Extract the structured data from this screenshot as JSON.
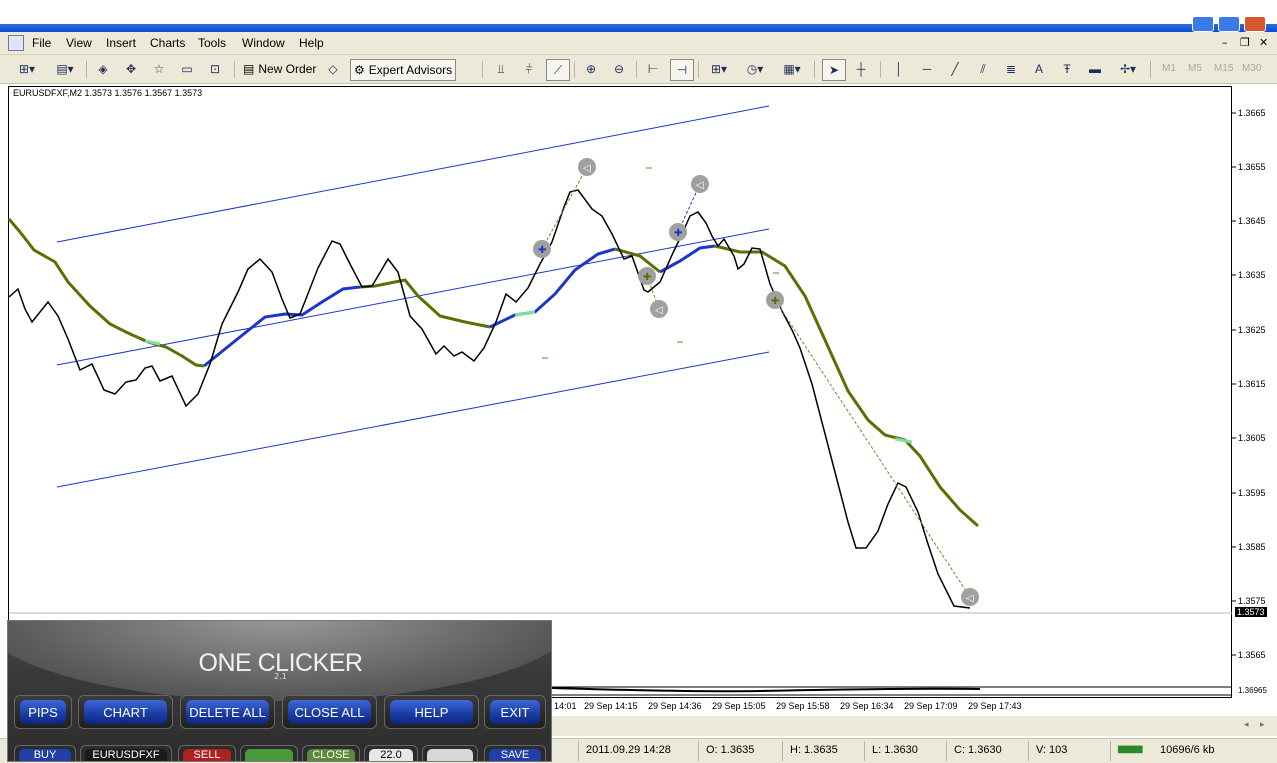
{
  "menu": {
    "items": [
      "File",
      "View",
      "Insert",
      "Charts",
      "Tools",
      "Window",
      "Help"
    ]
  },
  "toolbar": {
    "new_order": "New Order",
    "expert_advisors": "Expert Advisors",
    "timeframes": [
      "M1",
      "M5",
      "M15",
      "M30"
    ]
  },
  "chart": {
    "symbol_info": "EURUSDFXF,M2  1.3573 1.3576 1.3567 1.3573",
    "price_labels": [
      "1.3665",
      "1.3655",
      "1.3645",
      "1.3635",
      "1.3625",
      "1.3615",
      "1.3605",
      "1.3595",
      "1.3585",
      "1.3575",
      "1.3565"
    ],
    "current_price": "1.3573",
    "indicator_label": "1.36965",
    "time_labels": [
      "14:01",
      "29 Sep 14:15",
      "29 Sep 14:36",
      "29 Sep 15:05",
      "29 Sep 15:58",
      "29 Sep 16:34",
      "29 Sep 17:09",
      "29 Sep 17:43"
    ],
    "colors": {
      "price": "#000000",
      "ma_up": "#1c36c8",
      "ma_down": "#5a7000",
      "ma_flat": "#7ee0a0",
      "channel": "#1c36c8"
    }
  },
  "panel": {
    "title": "ONE CLICKER",
    "version": "2.1",
    "buttons": [
      "PIPS",
      "CHART",
      "DELETE ALL",
      "CLOSE ALL",
      "HELP",
      "EXIT"
    ],
    "row2": [
      "BUY",
      "EURUSDFXF",
      "SELL",
      "",
      "CLOSE",
      "22.0",
      "",
      "SAVE"
    ]
  },
  "status": {
    "datetime": "2011.09.29 14:28",
    "open": "O: 1.3635",
    "high": "H: 1.3635",
    "low": "L: 1.3630",
    "close": "C: 1.3630",
    "volume": "V: 103",
    "traffic": "10696/6 kb"
  }
}
